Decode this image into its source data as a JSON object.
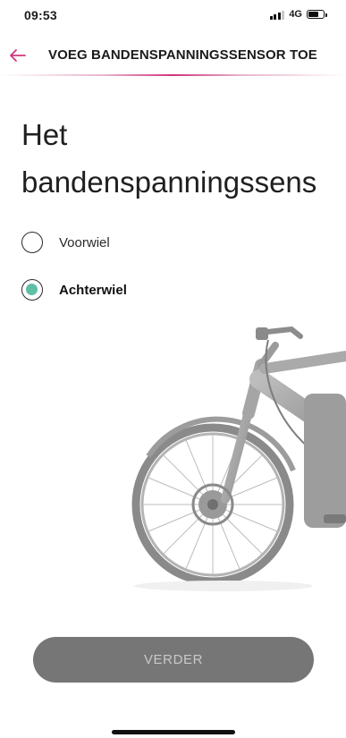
{
  "status_bar": {
    "time": "09:53",
    "network": "4G",
    "battery_level": 0.6
  },
  "header": {
    "title": "VOEG BANDENSPANNINGSSENSOR TOE",
    "accent_color": "#d0357a",
    "back_icon": "arrow-left-icon"
  },
  "question": {
    "line1": "Het",
    "line2": "bandenspanningssens"
  },
  "options": [
    {
      "label": "Voorwiel",
      "selected": false
    },
    {
      "label": "Achterwiel",
      "selected": true
    }
  ],
  "radio_selected_color": "#5fbfa6",
  "next_button": {
    "label": "VERDER",
    "enabled": false
  }
}
